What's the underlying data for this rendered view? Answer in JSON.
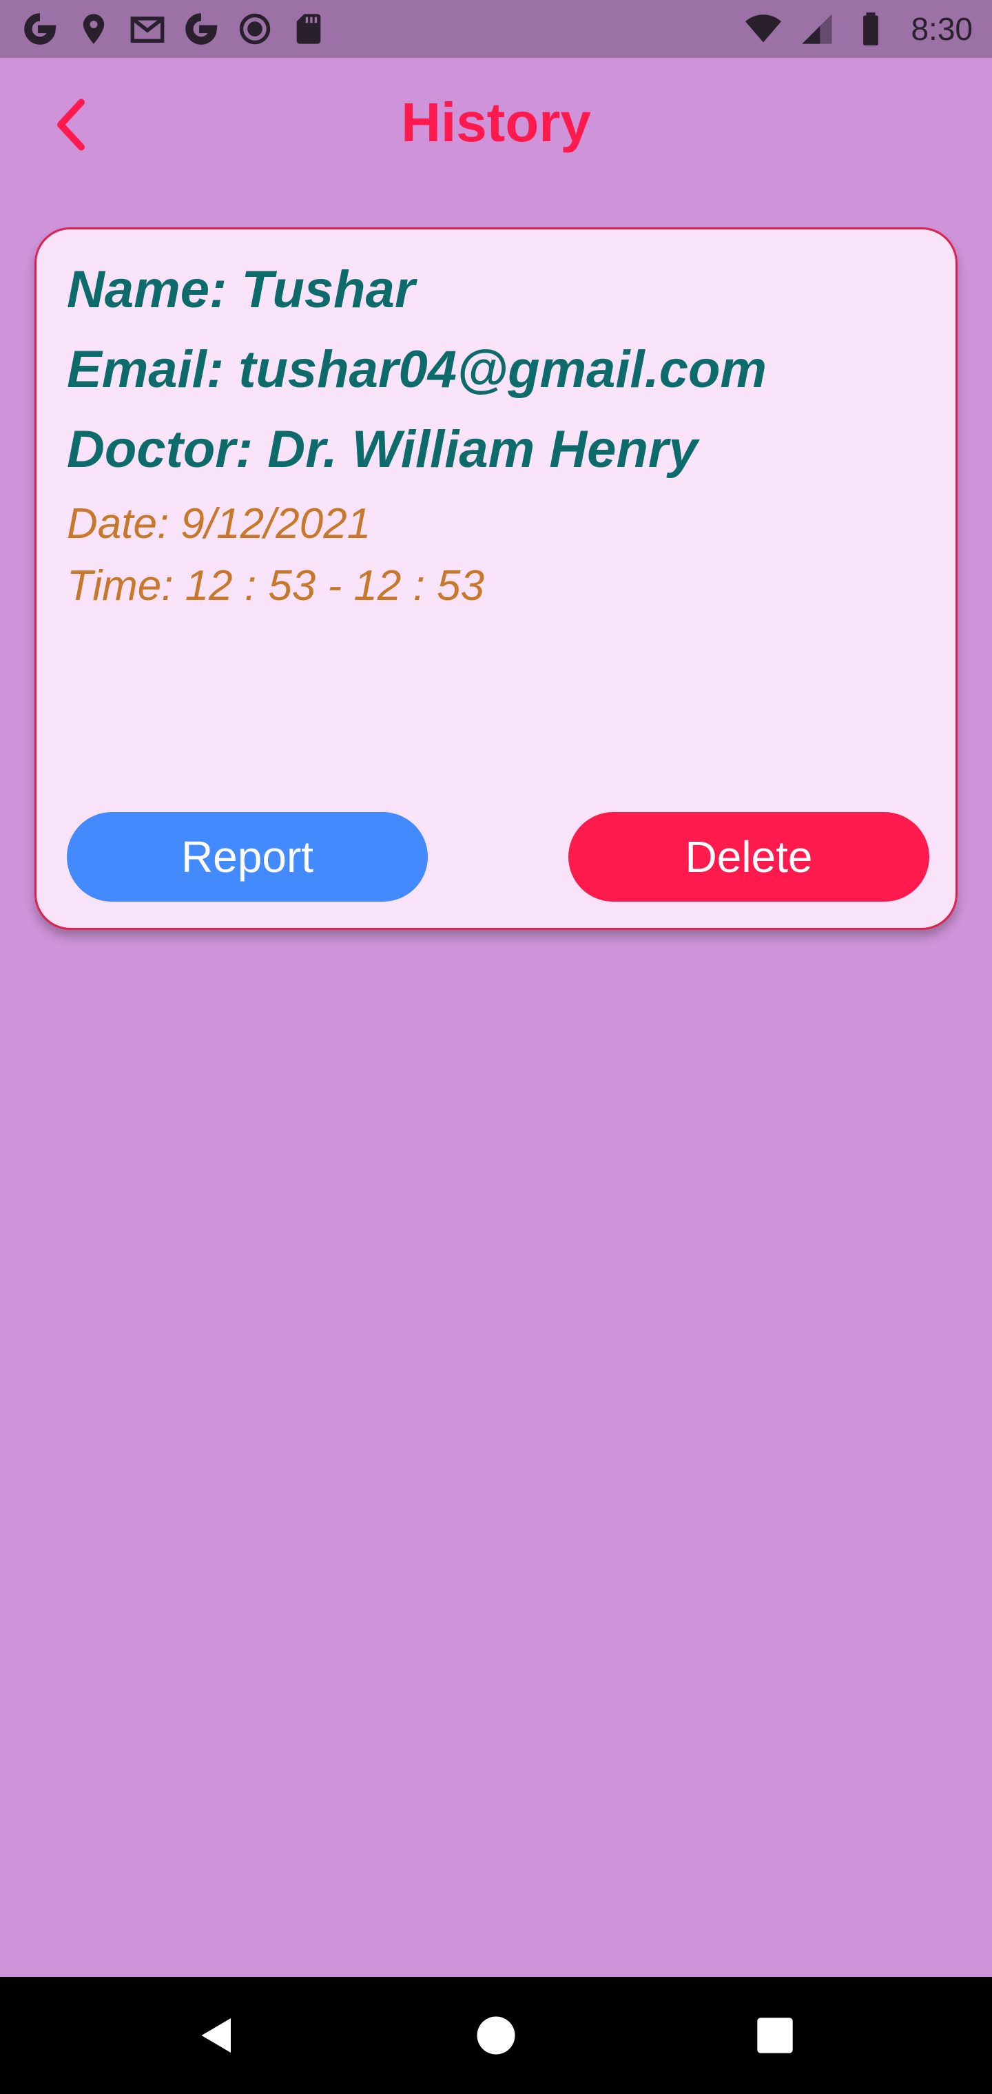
{
  "status_bar": {
    "time": "8:30",
    "left_icons": [
      "google-icon",
      "location-pin-icon",
      "gmail-icon",
      "google-icon",
      "circle-record-icon",
      "sd-card-icon"
    ],
    "right_icons": [
      "wifi-icon",
      "cell-signal-icon",
      "battery-icon"
    ]
  },
  "app_bar": {
    "title": "History",
    "back_icon": "chevron-left-icon"
  },
  "history": {
    "items": [
      {
        "name": "Name: Tushar",
        "email": "Email: tushar04@gmail.com",
        "doctor": "Doctor: Dr. William Henry",
        "date": "Date: 9/12/2021",
        "time": "Time: 12 : 53 - 12 : 53",
        "report_label": "Report",
        "delete_label": "Delete"
      }
    ]
  },
  "nav_bar": {
    "icons": [
      "nav-back-icon",
      "nav-home-icon",
      "nav-recent-icon"
    ]
  },
  "colors": {
    "background": "#ce93d8",
    "status_bar": "#9c72a6",
    "accent": "#ff1a4e",
    "card_background": "#f8e3f8",
    "card_text": "#0d6b6b",
    "card_subtext": "#c7782a",
    "report_button": "#448aff",
    "delete_button": "#ff1a4e"
  }
}
